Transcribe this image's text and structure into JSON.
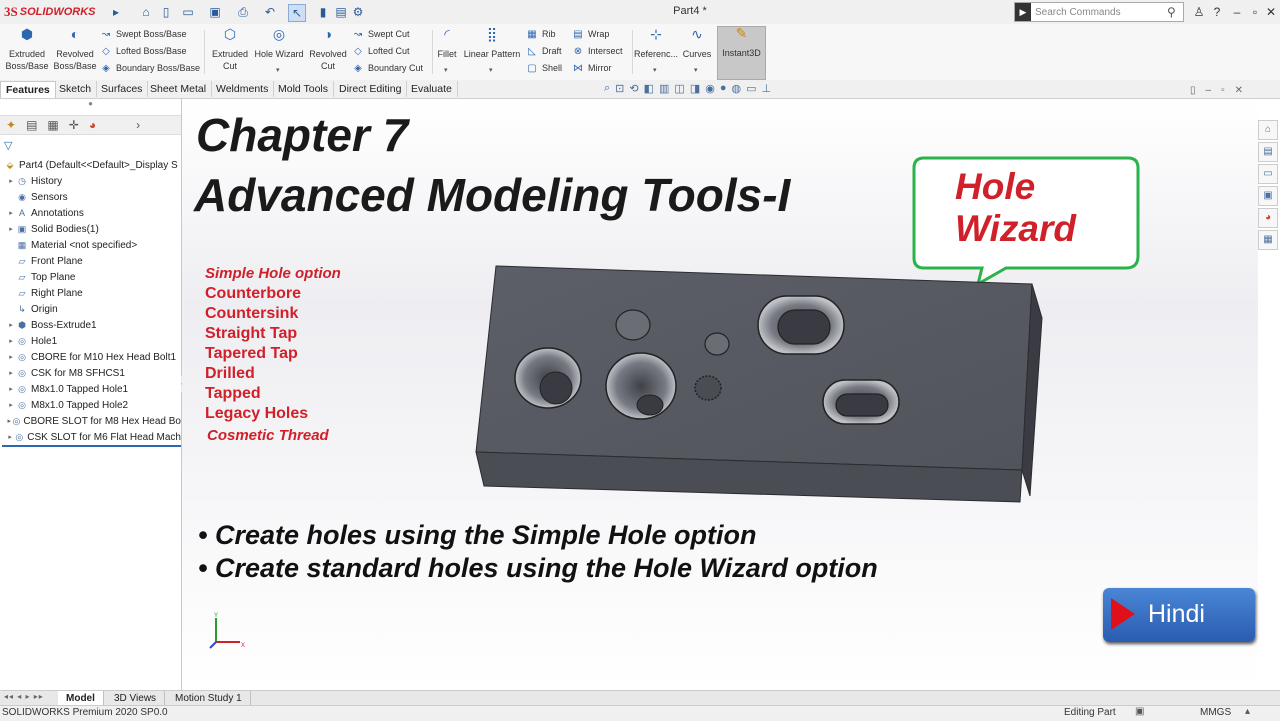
{
  "app": {
    "logo_ds": "3S",
    "logo_text": "SOLIDWORKS",
    "document_title": "Part4 *",
    "search_placeholder": "Search Commands"
  },
  "ribbon": {
    "extruded_boss": "Extruded Boss/Base",
    "revolved_boss": "Revolved Boss/Base",
    "swept_boss": "Swept Boss/Base",
    "lofted_boss": "Lofted Boss/Base",
    "boundary_boss": "Boundary Boss/Base",
    "extruded_cut": "Extruded Cut",
    "hole_wizard": "Hole Wizard",
    "revolved_cut": "Revolved Cut",
    "swept_cut": "Swept Cut",
    "lofted_cut": "Lofted Cut",
    "boundary_cut": "Boundary Cut",
    "fillet": "Fillet",
    "linear_pattern": "Linear Pattern",
    "rib": "Rib",
    "draft": "Draft",
    "shell": "Shell",
    "wrap": "Wrap",
    "intersect": "Intersect",
    "mirror": "Mirror",
    "reference": "Referenc...",
    "curves": "Curves",
    "instant3d": "Instant3D"
  },
  "tabs": [
    "Features",
    "Sketch",
    "Surfaces",
    "Sheet Metal",
    "Weldments",
    "Mold Tools",
    "Direct Editing",
    "Evaluate"
  ],
  "tree": {
    "root": "Part4  (Default<<Default>_Display S",
    "items": [
      {
        "label": "History",
        "icon": "history-icon",
        "expandable": true
      },
      {
        "label": "Sensors",
        "icon": "sensor-icon",
        "expandable": false
      },
      {
        "label": "Annotations",
        "icon": "annotation-icon",
        "expandable": true
      },
      {
        "label": "Solid Bodies(1)",
        "icon": "solid-bodies-icon",
        "expandable": true
      },
      {
        "label": "Material <not specified>",
        "icon": "material-icon",
        "expandable": false
      },
      {
        "label": "Front Plane",
        "icon": "plane-icon",
        "expandable": false
      },
      {
        "label": "Top Plane",
        "icon": "plane-icon",
        "expandable": false
      },
      {
        "label": "Right Plane",
        "icon": "plane-icon",
        "expandable": false
      },
      {
        "label": "Origin",
        "icon": "origin-icon",
        "expandable": false
      },
      {
        "label": "Boss-Extrude1",
        "icon": "extrude-icon",
        "expandable": true
      },
      {
        "label": "Hole1",
        "icon": "hole-icon",
        "expandable": true
      },
      {
        "label": "CBORE for M10 Hex Head Bolt1",
        "icon": "hole-wizard-icon",
        "expandable": true
      },
      {
        "label": "CSK for M8 SFHCS1",
        "icon": "hole-wizard-icon",
        "expandable": true
      },
      {
        "label": "M8x1.0 Tapped Hole1",
        "icon": "hole-wizard-icon",
        "expandable": true
      },
      {
        "label": "M8x1.0 Tapped Hole2",
        "icon": "hole-wizard-icon",
        "expandable": true
      },
      {
        "label": "CBORE SLOT for M8 Hex Head Bo",
        "icon": "hole-wizard-icon",
        "expandable": true
      },
      {
        "label": "CSK SLOT for M6 Flat Head Mach",
        "icon": "hole-wizard-icon",
        "expandable": true
      }
    ]
  },
  "slide": {
    "title_line1": "Chapter 7",
    "title_line2": "Advanced Modeling Tools-I",
    "bubble_line1": "Hole",
    "bubble_line2": "Wizard",
    "options": [
      "Simple Hole option",
      "Counterbore",
      "Countersink",
      "Straight Tap",
      "Tapered Tap",
      "Drilled",
      "Tapped",
      "Legacy Holes",
      "Cosmetic Thread"
    ],
    "bullets": [
      "• Create holes using the Simple Hole option",
      "• Create standard holes using the Hole Wizard option"
    ],
    "hindi_button": "Hindi"
  },
  "bottom_tabs": [
    "Model",
    "3D Views",
    "Motion Study 1"
  ],
  "status": {
    "product": "SOLIDWORKS Premium 2020 SP0.0",
    "mode": "Editing Part",
    "units": "MMGS"
  },
  "colors": {
    "accent_red": "#d0202a",
    "hindi_blue": "#3a72c4",
    "bubble_green": "#2ab34a",
    "block_gray": "#5b5d66"
  }
}
